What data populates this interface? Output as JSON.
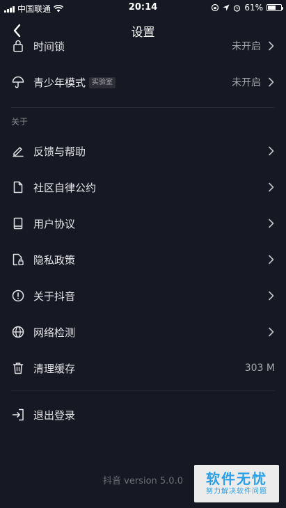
{
  "status_bar": {
    "carrier": "中国联通",
    "time": "20:14",
    "battery_text": "61%",
    "battery_level": 0.61
  },
  "nav": {
    "title": "设置"
  },
  "rows_top": [
    {
      "label": "时间锁",
      "value": "未开启"
    },
    {
      "label": "青少年模式",
      "tag": "实验室",
      "value": "未开启"
    }
  ],
  "section_about": {
    "header": "关于",
    "items": [
      {
        "label": "反馈与帮助"
      },
      {
        "label": "社区自律公约"
      },
      {
        "label": "用户协议"
      },
      {
        "label": "隐私政策"
      },
      {
        "label": "关于抖音"
      },
      {
        "label": "网络检测"
      },
      {
        "label": "清理缓存",
        "value": "303 M"
      }
    ]
  },
  "logout": {
    "label": "退出登录"
  },
  "footer": {
    "version": "抖音 version 5.0.0"
  },
  "watermark": {
    "line1": "软件无忧",
    "line2": "努力解决软件问题"
  },
  "colors": {
    "background": "#161823",
    "text": "#e6e6ea",
    "secondary": "#a9a9b0",
    "watermark": "#2aa0e8"
  }
}
